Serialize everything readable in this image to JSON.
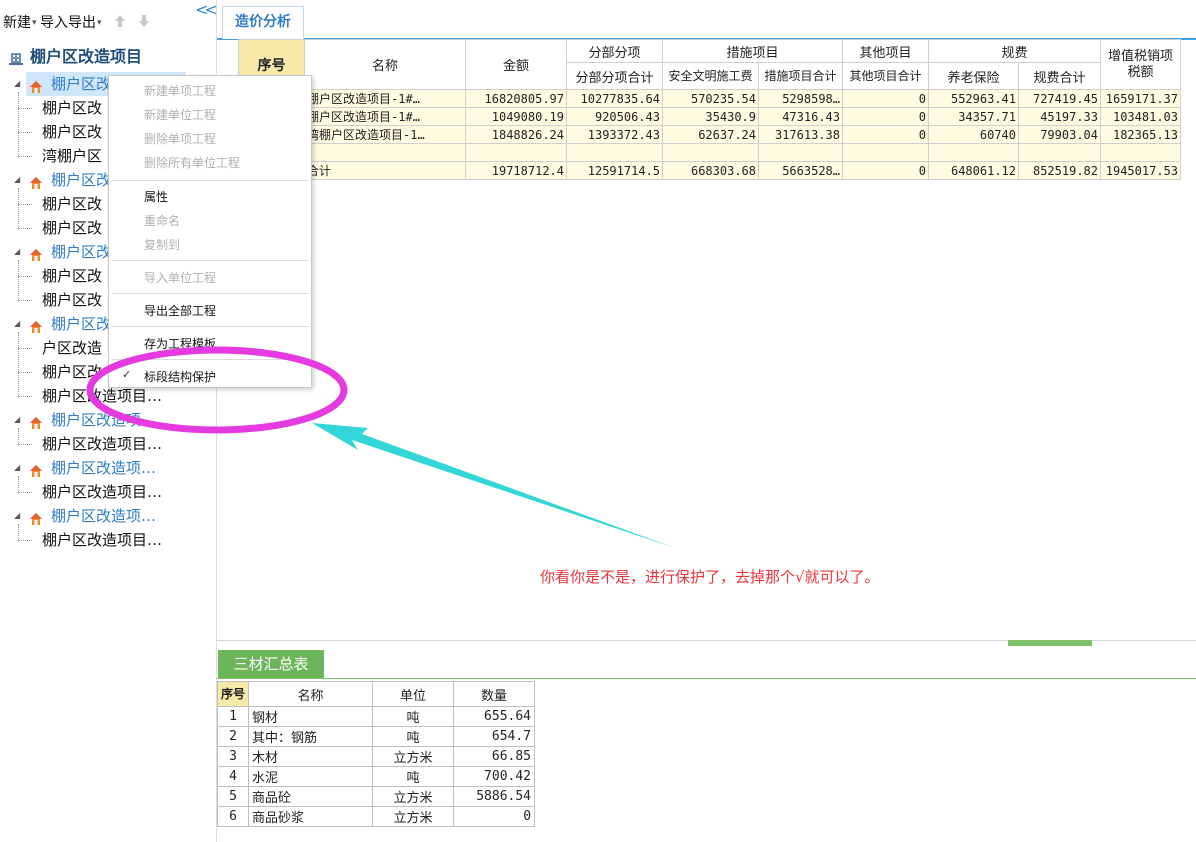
{
  "toolbar": {
    "new_label": "新建",
    "import_export_label": "导入导出"
  },
  "tree": {
    "root": "棚户区改造项目",
    "nodes": [
      {
        "label": "棚户区改",
        "leaves": [
          "棚户区改",
          "棚户区改",
          "湾棚户区"
        ]
      },
      {
        "label": "棚户区改",
        "leaves": [
          "棚户区改",
          "棚户区改"
        ]
      },
      {
        "label": "棚户区改",
        "leaves": [
          "棚户区改",
          "棚户区改"
        ]
      },
      {
        "label": "棚户区改",
        "leaves": [
          "户区改造",
          "棚户区改",
          "棚户区改造项目…"
        ]
      },
      {
        "label": "棚户区改造项…",
        "leaves": [
          "棚户区改造项目…"
        ]
      },
      {
        "label": "棚户区改造项…",
        "leaves": [
          "棚户区改造项目…"
        ]
      },
      {
        "label": "棚户区改造项…",
        "leaves": [
          "棚户区改造项目…"
        ]
      }
    ]
  },
  "context_menu": {
    "items": [
      {
        "label": "新建单项工程",
        "enabled": false
      },
      {
        "label": "新建单位工程",
        "enabled": false
      },
      {
        "label": "删除单项工程",
        "enabled": false
      },
      {
        "label": "删除所有单位工程",
        "enabled": false
      },
      {
        "label": "属性",
        "enabled": true
      },
      {
        "label": "重命名",
        "enabled": false
      },
      {
        "label": "复制到",
        "enabled": false
      },
      {
        "label": "导入单位工程",
        "enabled": false
      },
      {
        "label": "导出全部工程",
        "enabled": true
      },
      {
        "label": "存为工程模板",
        "enabled": true
      },
      {
        "label": "标段结构保护",
        "enabled": true,
        "checked": true
      }
    ],
    "check_mark": "✓"
  },
  "tab": {
    "label": "造价分析"
  },
  "cost_table": {
    "headers": {
      "seq": "序号",
      "name": "名称",
      "amount": "金额",
      "sub_items": "分部分项",
      "sub_items_total": "分部分项合计",
      "measures": "措施项目",
      "safety_fee": "安全文明施工费",
      "measures_total": "措施项目合计",
      "other": "其他项目",
      "other_total": "其他项目合计",
      "fees": "规费",
      "pension": "养老保险",
      "fees_total": "规费合计",
      "vat": "增值税销项税额"
    },
    "rows": [
      {
        "name": "棚户区改造项目-1#…",
        "amount": "16820805.97",
        "sub_total": "10277835.64",
        "safety": "570235.54",
        "measures_total": "5298598…",
        "other_total": "0",
        "pension": "552963.41",
        "fees_total": "727419.45",
        "vat": "1659171.37"
      },
      {
        "name": "棚户区改造项目-1#…",
        "amount": "1049080.19",
        "sub_total": "920506.43",
        "safety": "35430.9",
        "measures_total": "47316.43",
        "other_total": "0",
        "pension": "34357.71",
        "fees_total": "45197.33",
        "vat": "103481.03"
      },
      {
        "name": "湾棚户区改造项目-1…",
        "amount": "1848826.24",
        "sub_total": "1393372.43",
        "safety": "62637.24",
        "measures_total": "317613.38",
        "other_total": "0",
        "pension": "60740",
        "fees_total": "79903.04",
        "vat": "182365.13"
      }
    ],
    "total_row": {
      "name": "合计",
      "amount": "19718712.4",
      "sub_total": "12591714.5",
      "safety": "668303.68",
      "measures_total": "5663528…",
      "other_total": "0",
      "pension": "648061.12",
      "fees_total": "852519.82",
      "vat": "1945017.53"
    }
  },
  "annotation": "你看你是不是，进行保护了，去掉那个√就可以了。",
  "bottom": {
    "tab_label": "三材汇总表",
    "headers": {
      "seq": "序号",
      "name": "名称",
      "unit": "单位",
      "qty": "数量"
    },
    "rows": [
      {
        "seq": "1",
        "name": "钢材",
        "unit": "吨",
        "qty": "655.64"
      },
      {
        "seq": "2",
        "name": "其中：钢筋",
        "unit": "吨",
        "qty": "654.7"
      },
      {
        "seq": "3",
        "name": "木材",
        "unit": "立方米",
        "qty": "66.85"
      },
      {
        "seq": "4",
        "name": "水泥",
        "unit": "吨",
        "qty": "700.42"
      },
      {
        "seq": "5",
        "name": "商品砼",
        "unit": "立方米",
        "qty": "5886.54"
      },
      {
        "seq": "6",
        "name": "商品砂浆",
        "unit": "立方米",
        "qty": "0"
      }
    ]
  },
  "colors": {
    "accent_blue": "#2e7dc4",
    "annotation_red": "#e8353b",
    "highlight_magenta": "#e53ae0",
    "arrow_cyan": "#33d6d6",
    "tab_green": "#6cb55a"
  }
}
